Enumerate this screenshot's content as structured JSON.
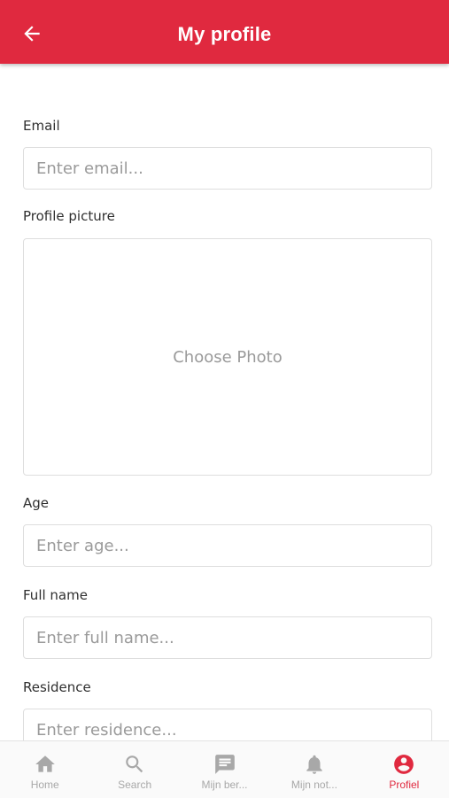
{
  "header": {
    "title": "My profile",
    "back_icon": "arrow-left-icon",
    "color": "#e0293f"
  },
  "form": {
    "email": {
      "label": "Email",
      "placeholder": "Enter email..."
    },
    "photo": {
      "label": "Profile picture",
      "button_text": "Choose Photo"
    },
    "age": {
      "label": "Age",
      "placeholder": "Enter age..."
    },
    "full_name": {
      "label": "Full name",
      "placeholder": "Enter full name..."
    },
    "residence": {
      "label": "Residence",
      "placeholder": "Enter residence..."
    }
  },
  "bottom_nav": {
    "active": "Profiel",
    "active_color": "#e0293f",
    "inactive_color": "#a8a8a8",
    "items": [
      {
        "label": "Home",
        "icon": "home-icon"
      },
      {
        "label": "Search",
        "icon": "search-icon"
      },
      {
        "label": "Mijn ber...",
        "icon": "message-icon"
      },
      {
        "label": "Mijn not...",
        "icon": "bell-icon"
      },
      {
        "label": "Profiel",
        "icon": "account-circle-icon"
      }
    ]
  }
}
